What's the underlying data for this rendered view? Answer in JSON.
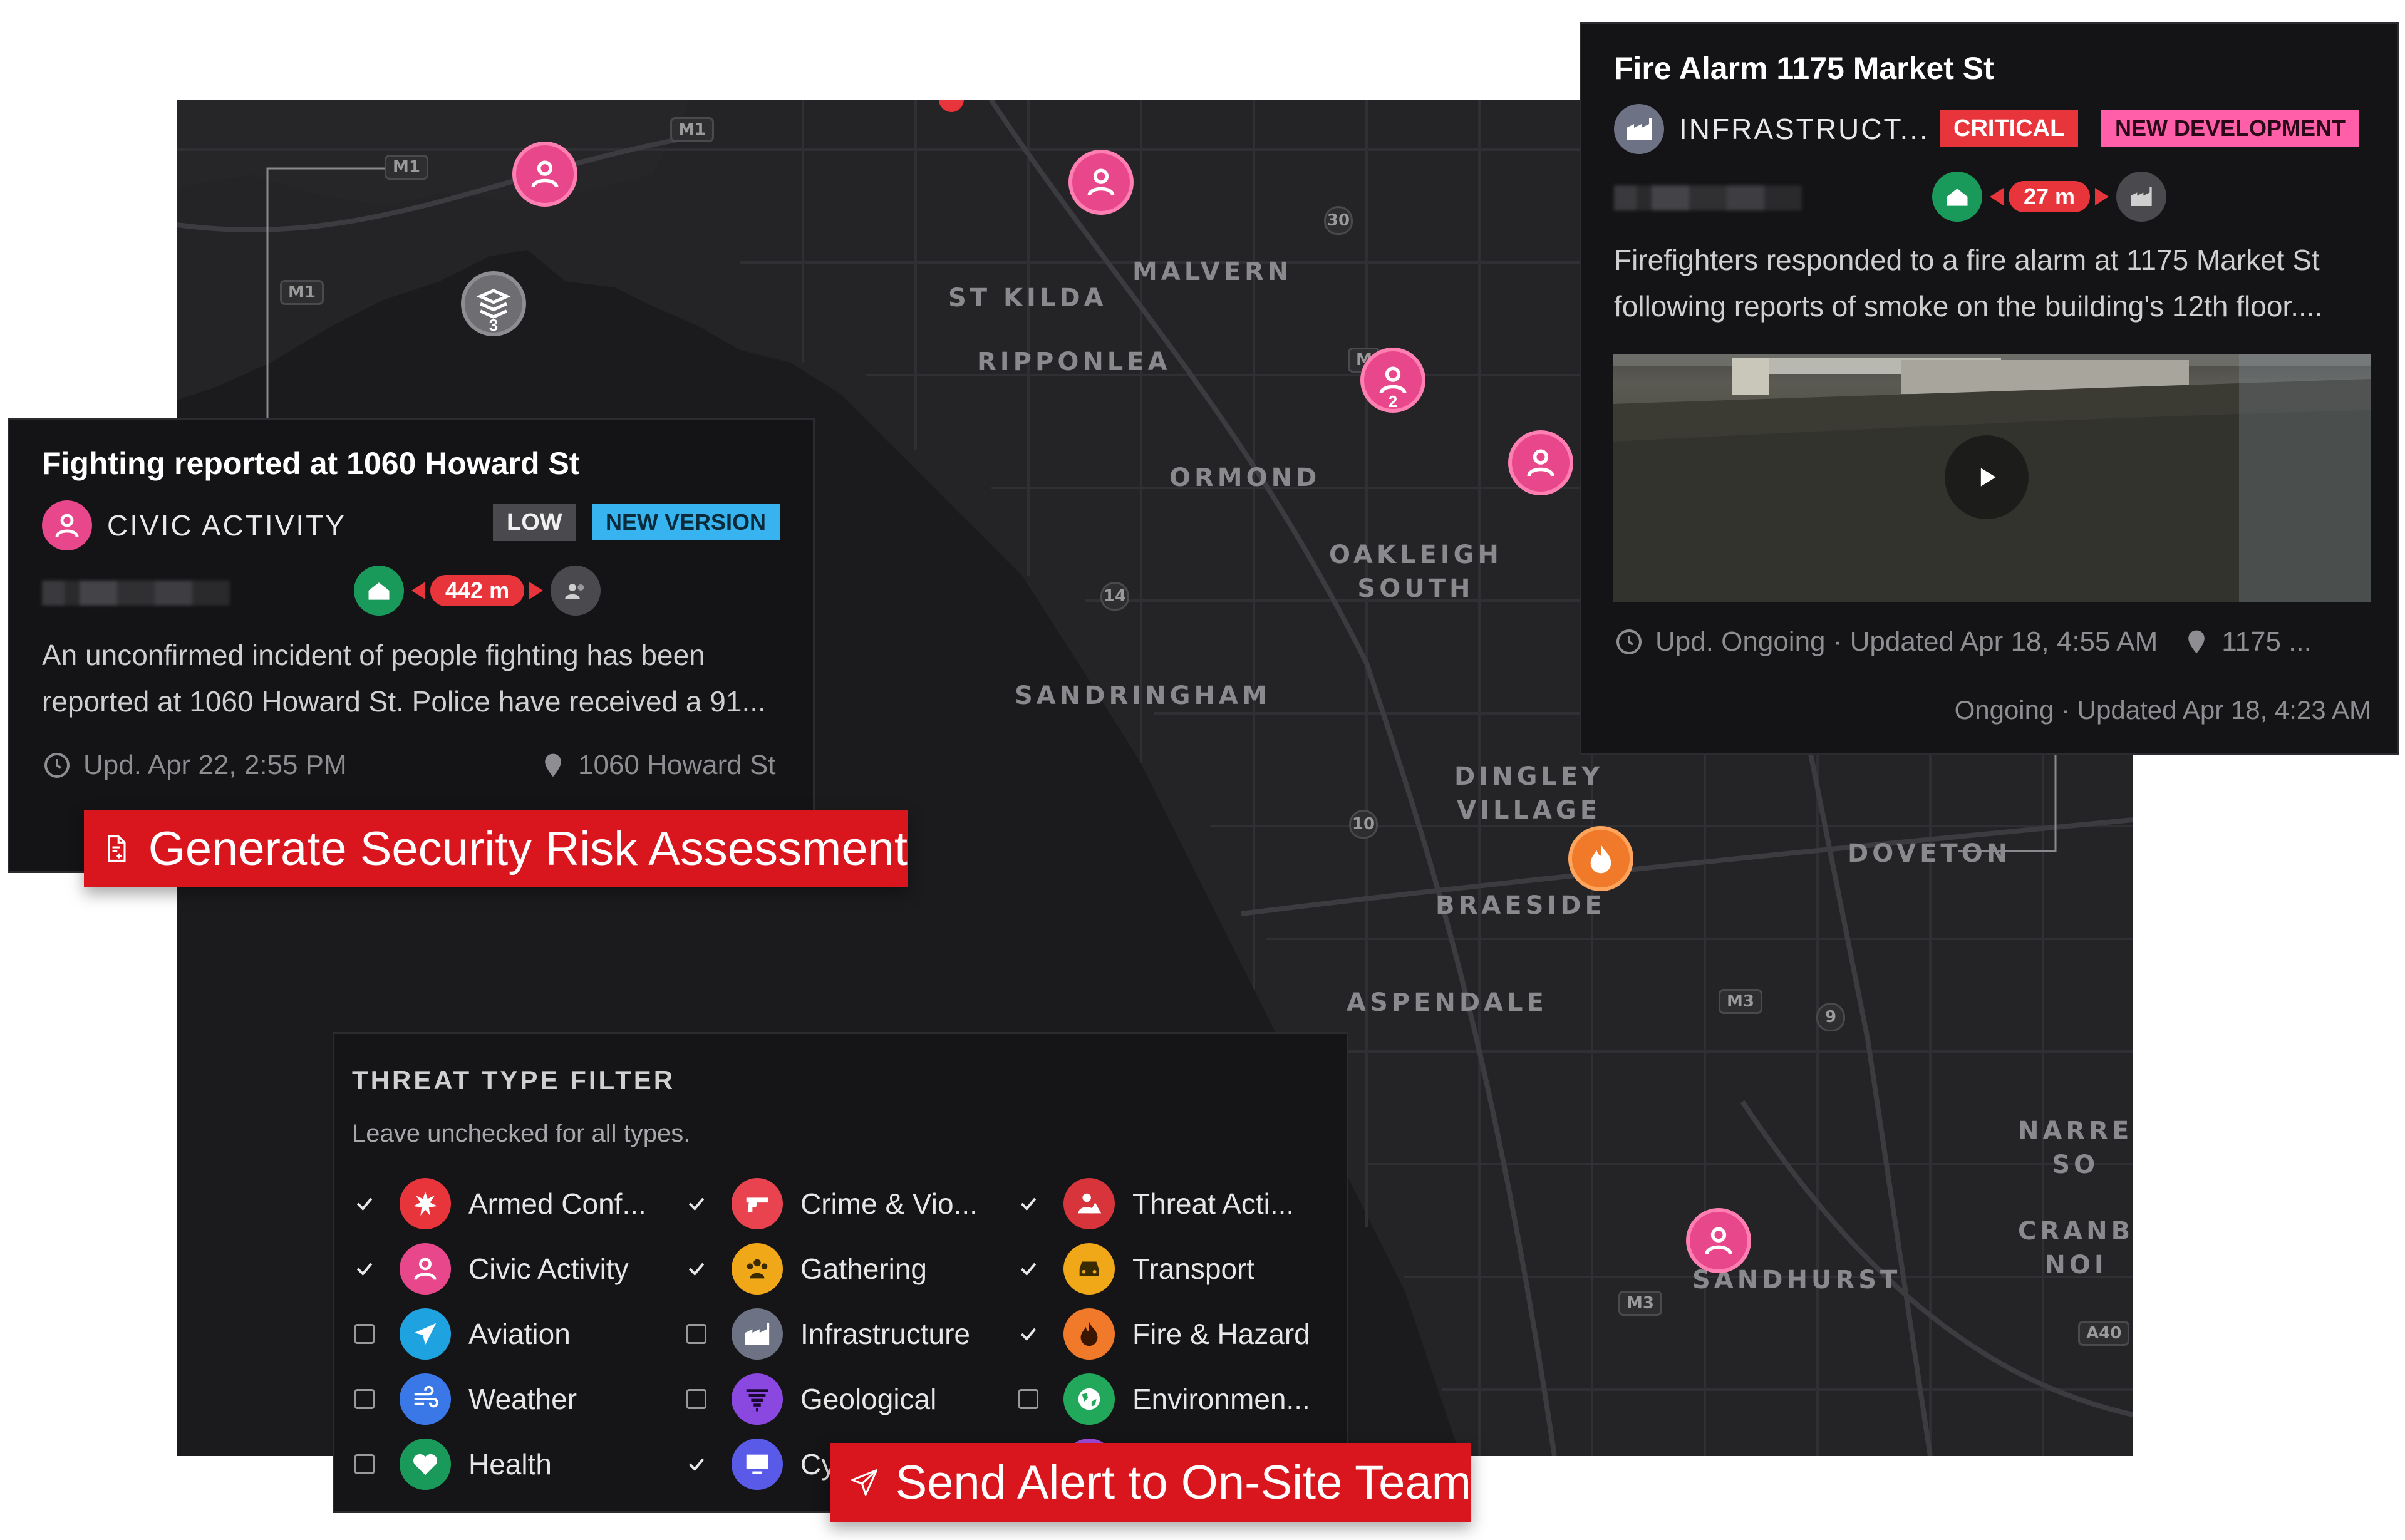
{
  "map": {
    "places": [
      "ST KILDA",
      "MALVERN",
      "RIPPONLEA",
      "ORMOND",
      "OAKLEIGH\nSOUTH",
      "SANDRINGHAM",
      "DINGLEY\nVILLAGE",
      "BRAESIDE",
      "DOVETON",
      "ASPENDALE",
      "NARRE\nSO",
      "CRANB\nNOI",
      "SANDHURST"
    ],
    "road_shields": [
      "M1",
      "M1",
      "M1",
      "30",
      "M",
      "14",
      "10",
      "M3",
      "9",
      "M3",
      "A40"
    ],
    "cluster_counts": [
      "3",
      "2"
    ]
  },
  "card_left": {
    "title": "Fighting reported at 1060 Howard St",
    "category": "CIVIC ACTIVITY",
    "severity": "LOW",
    "status": "NEW VERSION",
    "distance": "442 m",
    "description": "An unconfirmed incident of people fighting has been reported at 1060 Howard St. Police have received a 91...",
    "updated": "Upd. Apr 22, 2:55 PM",
    "location": "1060 Howard St",
    "colors": {
      "severity": "#4a4a4e",
      "status": "#37b4f0",
      "category": "#e8478b"
    }
  },
  "card_right": {
    "title": "Fire Alarm 1175 Market St",
    "category": "INFRASTRUCT...",
    "severity": "CRITICAL",
    "status": "NEW DEVELOPMENT",
    "distance": "27 m",
    "description": "Firefighters responded to a fire alarm at 1175 Market St following reports of smoke on the building's 12th floor....",
    "updated": "Upd. Ongoing · Updated Apr 18, 4:55 AM",
    "location": "1175 ...",
    "footer": "Ongoing · Updated Apr 18, 4:23 AM",
    "colors": {
      "severity": "#e8343b",
      "status": "#ff5fa8"
    }
  },
  "cta_assessment": {
    "label": "Generate Security Risk Assessment",
    "icon": "document-add-icon"
  },
  "cta_alert": {
    "label": "Send Alert to On-Site Team",
    "icon": "send-icon"
  },
  "filter": {
    "title": "THREAT TYPE FILTER",
    "subtitle": "Leave unchecked for all types.",
    "items": [
      {
        "label": "Armed Conf...",
        "checked": true,
        "color": "#e8343b",
        "icon": "burst-icon"
      },
      {
        "label": "Crime & Vio...",
        "checked": true,
        "color": "#e8434f",
        "icon": "gun-icon"
      },
      {
        "label": "Threat Acti...",
        "checked": true,
        "color": "#d8343b",
        "icon": "threat-icon"
      },
      {
        "label": "Civic Activity",
        "checked": true,
        "color": "#e8478b",
        "icon": "people-icon"
      },
      {
        "label": "Gathering",
        "checked": true,
        "color": "#f0a818",
        "icon": "crowd-icon"
      },
      {
        "label": "Transport",
        "checked": true,
        "color": "#f0a818",
        "icon": "car-icon"
      },
      {
        "label": "Aviation",
        "checked": false,
        "color": "#1fa3e0",
        "icon": "plane-icon"
      },
      {
        "label": "Infrastructure",
        "checked": false,
        "color": "#6d7385",
        "icon": "factory-icon"
      },
      {
        "label": "Fire & Hazard",
        "checked": true,
        "color": "#f07a2a",
        "icon": "fire-icon"
      },
      {
        "label": "Weather",
        "checked": false,
        "color": "#3a78e8",
        "icon": "wind-icon"
      },
      {
        "label": "Geological",
        "checked": false,
        "color": "#8a48e0",
        "icon": "tornado-icon"
      },
      {
        "label": "Environmen...",
        "checked": false,
        "color": "#22a85a",
        "icon": "globe-icon"
      },
      {
        "label": "Health",
        "checked": false,
        "color": "#1a9a5a",
        "icon": "heart-icon"
      },
      {
        "label": "Cy",
        "checked": true,
        "color": "#5a5ae8",
        "icon": "monitor-icon"
      }
    ]
  }
}
